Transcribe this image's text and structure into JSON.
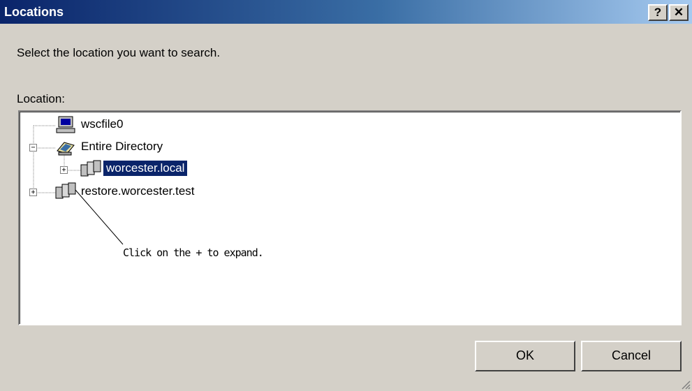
{
  "window": {
    "title": "Locations",
    "help_label": "?",
    "close_label": "✕"
  },
  "prompt": "Select the location you want to search.",
  "location_label": "Location:",
  "tree": {
    "nodes": [
      {
        "label": "wscfile0",
        "icon": "computer-icon"
      },
      {
        "label": "Entire Directory",
        "icon": "directory-icon",
        "expander": "−"
      },
      {
        "label": "worcester.local",
        "icon": "domain-icon",
        "expander": "+",
        "selected": true
      },
      {
        "label": "restore.worcester.test",
        "icon": "domain-icon",
        "expander": "+"
      }
    ]
  },
  "annotation": "Click on the + to expand.",
  "buttons": {
    "ok": "OK",
    "cancel": "Cancel"
  },
  "colors": {
    "selection": "#0a246a",
    "dialog_bg": "#d4d0c8",
    "title_start": "#0a246a"
  }
}
